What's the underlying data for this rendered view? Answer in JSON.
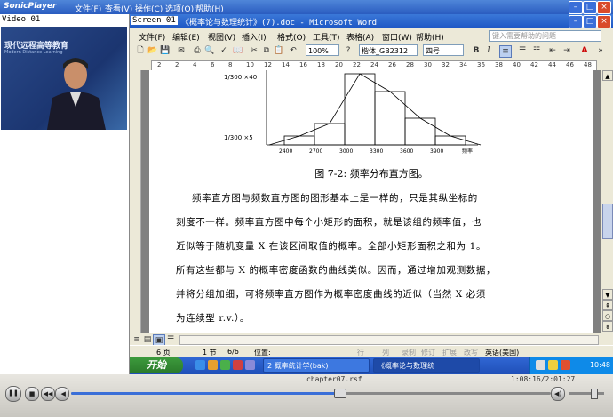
{
  "player": {
    "logo": "SonicPlayer",
    "menu": [
      "文件(F)",
      "查看(V)",
      "操作(C)",
      "选项(O)",
      "帮助(H)"
    ],
    "video_label": "Video 01",
    "video_banner": "现代远程高等教育",
    "video_banner_sub": "Modern Distance Learning",
    "screen_label": "Screen 01",
    "filename": "chapter07.rsf",
    "time": "1:08:16/2:01:27",
    "progress": 0.56,
    "volume": 0.7
  },
  "word": {
    "title": "《概率论与数理统计》(7).doc - Microsoft Word",
    "menu": [
      "文件(F)",
      "编辑(E)",
      "视图(V)",
      "插入(I)",
      "格式(O)",
      "工具(T)",
      "表格(A)",
      "窗口(W)",
      "帮助(H)"
    ],
    "help_placeholder": "键入需要帮助的问题",
    "zoom": "100%",
    "font": "楷体_GB2312",
    "size": "四号",
    "ruler_ticks": [
      "2",
      "2",
      "4",
      "6",
      "8",
      "10",
      "12",
      "14",
      "16",
      "18",
      "20",
      "22",
      "24",
      "26",
      "28",
      "30",
      "32",
      "34",
      "36",
      "38",
      "40",
      "42",
      "44",
      "46",
      "48"
    ]
  },
  "document": {
    "figure_y_top": "1/300 ×40",
    "figure_y_bottom": "1/300 ×5",
    "figure_x_label": "频率",
    "caption": "图 7-2: 频率分布直方图。",
    "paragraph_lines": [
      "频率直方图与频数直方图的图形基本上是一样的，只是其纵坐标的",
      "刻度不一样。频率直方图中每个小矩形的面积，就是该组的频率值，也",
      "近似等于随机变量 X 在该区间取值的概率。全部小矩形面积之和为 1。",
      "所有这些都与 X 的概率密度函数的曲线类似。因而，通过增加观测数据，",
      "并将分组加细，可将频率直方图作为概率密度曲线的近似（当然 X 必须",
      "为连续型 r.v.）。"
    ]
  },
  "chart_data": {
    "type": "bar",
    "categories": [
      "2400",
      "2700",
      "3000",
      "3300",
      "3600",
      "3900"
    ],
    "values": [
      5,
      12,
      40,
      30,
      15,
      5
    ],
    "xlabel": "频率"
  },
  "status": {
    "page": "6 页",
    "section": "1 节",
    "pages": "6/6",
    "position": "位置:",
    "row": "行",
    "col": "列",
    "rec": "录制",
    "trk": "修订",
    "ext": "扩展",
    "ovr": "改写",
    "lang": "英语(美国)"
  },
  "taskbar": {
    "start": "开始",
    "tasks": [
      "2 概率统计学(bak)",
      "《概率论与数理统"
    ],
    "clock": "10:48"
  }
}
